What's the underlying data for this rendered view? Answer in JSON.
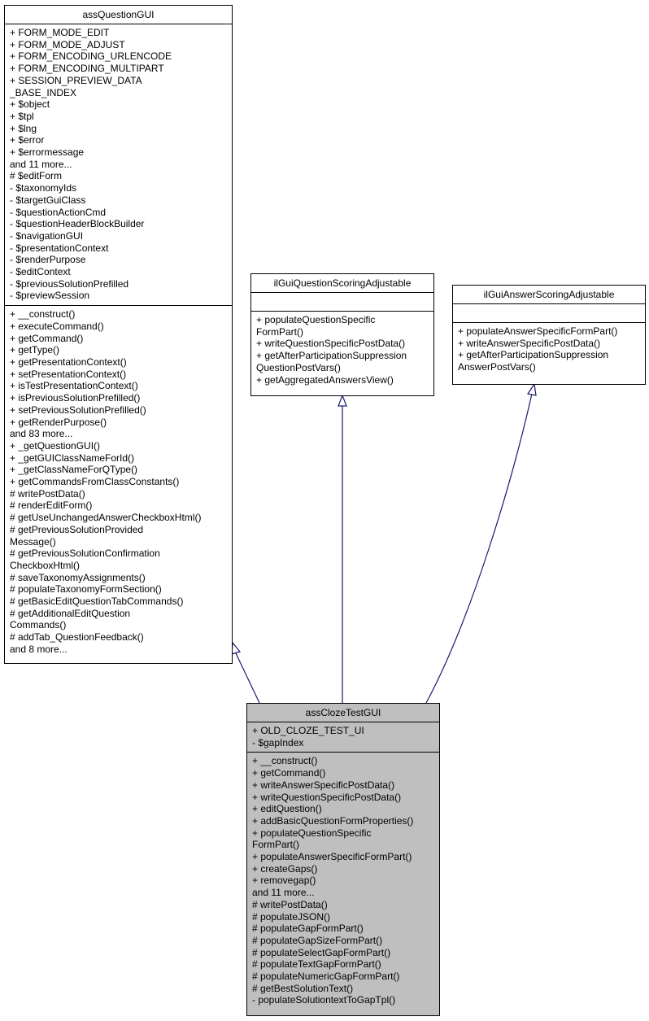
{
  "diagram": {
    "classes": {
      "assQuestionGUI": {
        "name": "assQuestionGUI",
        "attributes": [
          "+ FORM_MODE_EDIT",
          "+ FORM_MODE_ADJUST",
          "+ FORM_ENCODING_URLENCODE",
          "+ FORM_ENCODING_MULTIPART",
          "+ SESSION_PREVIEW_DATA",
          "_BASE_INDEX",
          "+ $object",
          "+ $tpl",
          "+ $lng",
          "+ $error",
          "+ $errormessage",
          "and 11 more...",
          "# $editForm",
          "- $taxonomyIds",
          "- $targetGuiClass",
          "- $questionActionCmd",
          "- $questionHeaderBlockBuilder",
          "- $navigationGUI",
          "- $presentationContext",
          "- $renderPurpose",
          "- $editContext",
          "- $previousSolutionPrefilled",
          "- $previewSession"
        ],
        "methods": [
          "+ __construct()",
          "+ executeCommand()",
          "+ getCommand()",
          "+ getType()",
          "+ getPresentationContext()",
          "+ setPresentationContext()",
          "+ isTestPresentationContext()",
          "+ isPreviousSolutionPrefilled()",
          "+ setPreviousSolutionPrefilled()",
          "+ getRenderPurpose()",
          "and 83 more...",
          "+ _getQuestionGUI()",
          "+ _getGUIClassNameForId()",
          "+ _getClassNameForQType()",
          "+ getCommandsFromClassConstants()",
          "# writePostData()",
          "# renderEditForm()",
          "# getUseUnchangedAnswerCheckboxHtml()",
          "# getPreviousSolutionProvided",
          "Message()",
          "# getPreviousSolutionConfirmation",
          "CheckboxHtml()",
          "# saveTaxonomyAssignments()",
          "# populateTaxonomyFormSection()",
          "# getBasicEditQuestionTabCommands()",
          "# getAdditionalEditQuestion",
          "Commands()",
          "# addTab_QuestionFeedback()",
          "and 8 more..."
        ]
      },
      "ilGuiQuestionScoringAdjustable": {
        "name": "ilGuiQuestionScoringAdjustable",
        "attributes": [],
        "methods": [
          "+ populateQuestionSpecific",
          "FormPart()",
          "+ writeQuestionSpecificPostData()",
          "+ getAfterParticipationSuppression",
          "QuestionPostVars()",
          "+ getAggregatedAnswersView()"
        ]
      },
      "ilGuiAnswerScoringAdjustable": {
        "name": "ilGuiAnswerScoringAdjustable",
        "attributes": [],
        "methods": [
          "+ populateAnswerSpecificFormPart()",
          "+ writeAnswerSpecificPostData()",
          "+ getAfterParticipationSuppression",
          "AnswerPostVars()"
        ]
      },
      "assClozeTestGUI": {
        "name": "assClozeTestGUI",
        "attributes": [
          "+ OLD_CLOZE_TEST_UI",
          "- $gapIndex"
        ],
        "methods": [
          "+ __construct()",
          "+ getCommand()",
          "+ writeAnswerSpecificPostData()",
          "+ writeQuestionSpecificPostData()",
          "+ editQuestion()",
          "+ addBasicQuestionFormProperties()",
          "+ populateQuestionSpecific",
          "FormPart()",
          "+ populateAnswerSpecificFormPart()",
          "+ createGaps()",
          "+ removegap()",
          "and 11 more...",
          "# writePostData()",
          "# populateJSON()",
          "# populateGapFormPart()",
          "# populateGapSizeFormPart()",
          "# populateSelectGapFormPart()",
          "# populateTextGapFormPart()",
          "# populateNumericGapFormPart()",
          "# getBestSolutionText()",
          "- populateSolutiontextToGapTpl()"
        ]
      }
    },
    "relations": [
      {
        "from": "assClozeTestGUI",
        "to": "assQuestionGUI",
        "type": "inheritance"
      },
      {
        "from": "assClozeTestGUI",
        "to": "ilGuiQuestionScoringAdjustable",
        "type": "inheritance"
      },
      {
        "from": "assClozeTestGUI",
        "to": "ilGuiAnswerScoringAdjustable",
        "type": "inheritance"
      }
    ],
    "colors": {
      "edge": "#191970",
      "derived_fill": "#bfbfbf",
      "base_fill": "#ffffff"
    }
  }
}
